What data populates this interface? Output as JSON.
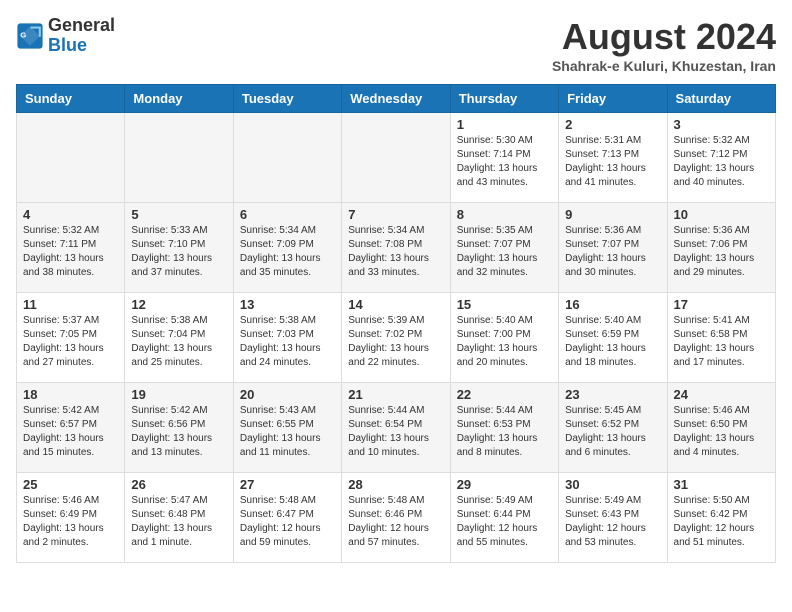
{
  "header": {
    "logo": {
      "line1": "General",
      "line2": "Blue"
    },
    "month": "August 2024",
    "location": "Shahrak-e Kuluri, Khuzestan, Iran"
  },
  "weekdays": [
    "Sunday",
    "Monday",
    "Tuesday",
    "Wednesday",
    "Thursday",
    "Friday",
    "Saturday"
  ],
  "weeks": [
    [
      {
        "day": "",
        "info": ""
      },
      {
        "day": "",
        "info": ""
      },
      {
        "day": "",
        "info": ""
      },
      {
        "day": "",
        "info": ""
      },
      {
        "day": "1",
        "info": "Sunrise: 5:30 AM\nSunset: 7:14 PM\nDaylight: 13 hours\nand 43 minutes."
      },
      {
        "day": "2",
        "info": "Sunrise: 5:31 AM\nSunset: 7:13 PM\nDaylight: 13 hours\nand 41 minutes."
      },
      {
        "day": "3",
        "info": "Sunrise: 5:32 AM\nSunset: 7:12 PM\nDaylight: 13 hours\nand 40 minutes."
      }
    ],
    [
      {
        "day": "4",
        "info": "Sunrise: 5:32 AM\nSunset: 7:11 PM\nDaylight: 13 hours\nand 38 minutes."
      },
      {
        "day": "5",
        "info": "Sunrise: 5:33 AM\nSunset: 7:10 PM\nDaylight: 13 hours\nand 37 minutes."
      },
      {
        "day": "6",
        "info": "Sunrise: 5:34 AM\nSunset: 7:09 PM\nDaylight: 13 hours\nand 35 minutes."
      },
      {
        "day": "7",
        "info": "Sunrise: 5:34 AM\nSunset: 7:08 PM\nDaylight: 13 hours\nand 33 minutes."
      },
      {
        "day": "8",
        "info": "Sunrise: 5:35 AM\nSunset: 7:07 PM\nDaylight: 13 hours\nand 32 minutes."
      },
      {
        "day": "9",
        "info": "Sunrise: 5:36 AM\nSunset: 7:07 PM\nDaylight: 13 hours\nand 30 minutes."
      },
      {
        "day": "10",
        "info": "Sunrise: 5:36 AM\nSunset: 7:06 PM\nDaylight: 13 hours\nand 29 minutes."
      }
    ],
    [
      {
        "day": "11",
        "info": "Sunrise: 5:37 AM\nSunset: 7:05 PM\nDaylight: 13 hours\nand 27 minutes."
      },
      {
        "day": "12",
        "info": "Sunrise: 5:38 AM\nSunset: 7:04 PM\nDaylight: 13 hours\nand 25 minutes."
      },
      {
        "day": "13",
        "info": "Sunrise: 5:38 AM\nSunset: 7:03 PM\nDaylight: 13 hours\nand 24 minutes."
      },
      {
        "day": "14",
        "info": "Sunrise: 5:39 AM\nSunset: 7:02 PM\nDaylight: 13 hours\nand 22 minutes."
      },
      {
        "day": "15",
        "info": "Sunrise: 5:40 AM\nSunset: 7:00 PM\nDaylight: 13 hours\nand 20 minutes."
      },
      {
        "day": "16",
        "info": "Sunrise: 5:40 AM\nSunset: 6:59 PM\nDaylight: 13 hours\nand 18 minutes."
      },
      {
        "day": "17",
        "info": "Sunrise: 5:41 AM\nSunset: 6:58 PM\nDaylight: 13 hours\nand 17 minutes."
      }
    ],
    [
      {
        "day": "18",
        "info": "Sunrise: 5:42 AM\nSunset: 6:57 PM\nDaylight: 13 hours\nand 15 minutes."
      },
      {
        "day": "19",
        "info": "Sunrise: 5:42 AM\nSunset: 6:56 PM\nDaylight: 13 hours\nand 13 minutes."
      },
      {
        "day": "20",
        "info": "Sunrise: 5:43 AM\nSunset: 6:55 PM\nDaylight: 13 hours\nand 11 minutes."
      },
      {
        "day": "21",
        "info": "Sunrise: 5:44 AM\nSunset: 6:54 PM\nDaylight: 13 hours\nand 10 minutes."
      },
      {
        "day": "22",
        "info": "Sunrise: 5:44 AM\nSunset: 6:53 PM\nDaylight: 13 hours\nand 8 minutes."
      },
      {
        "day": "23",
        "info": "Sunrise: 5:45 AM\nSunset: 6:52 PM\nDaylight: 13 hours\nand 6 minutes."
      },
      {
        "day": "24",
        "info": "Sunrise: 5:46 AM\nSunset: 6:50 PM\nDaylight: 13 hours\nand 4 minutes."
      }
    ],
    [
      {
        "day": "25",
        "info": "Sunrise: 5:46 AM\nSunset: 6:49 PM\nDaylight: 13 hours\nand 2 minutes."
      },
      {
        "day": "26",
        "info": "Sunrise: 5:47 AM\nSunset: 6:48 PM\nDaylight: 13 hours\nand 1 minute."
      },
      {
        "day": "27",
        "info": "Sunrise: 5:48 AM\nSunset: 6:47 PM\nDaylight: 12 hours\nand 59 minutes."
      },
      {
        "day": "28",
        "info": "Sunrise: 5:48 AM\nSunset: 6:46 PM\nDaylight: 12 hours\nand 57 minutes."
      },
      {
        "day": "29",
        "info": "Sunrise: 5:49 AM\nSunset: 6:44 PM\nDaylight: 12 hours\nand 55 minutes."
      },
      {
        "day": "30",
        "info": "Sunrise: 5:49 AM\nSunset: 6:43 PM\nDaylight: 12 hours\nand 53 minutes."
      },
      {
        "day": "31",
        "info": "Sunrise: 5:50 AM\nSunset: 6:42 PM\nDaylight: 12 hours\nand 51 minutes."
      }
    ]
  ]
}
